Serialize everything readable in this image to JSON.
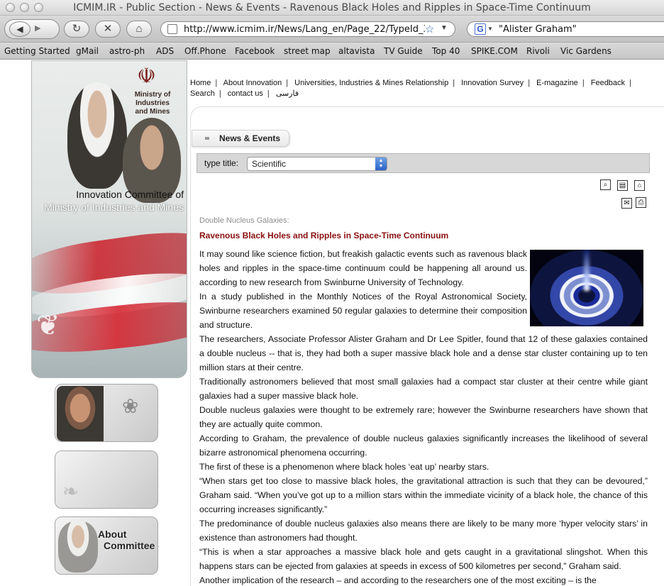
{
  "window": {
    "title": "ICMIM.IR - Public Section - News & Events - Ravenous Black Holes and Ripples in Space-Time Continuum"
  },
  "toolbar": {
    "back": "◀",
    "forward": "▶",
    "reload": "↻",
    "stop": "✕",
    "home": "⌂",
    "url": "http://www.icmim.ir/News/Lang_en/Page_22/TypeId_3/I",
    "search_engine": "G",
    "search_query": "\"Alister Graham\""
  },
  "bookmarks": [
    "Getting Started",
    "gMail",
    "astro-ph",
    "ADS",
    "Off.Phone",
    "Facebook",
    "street map",
    "altavista",
    "TV Guide",
    "Top 40",
    "SPIKE.COM",
    "Rivoli",
    "Vic Gardens"
  ],
  "banner": {
    "ministry_line1": "Ministry of Industries",
    "ministry_line2": "and Mines",
    "committee_title": "Innovation Committee of",
    "committee_sub": "Ministry of Industries and Mines"
  },
  "sidebar": {
    "about_line1": "About",
    "about_line2": "Committee"
  },
  "nav": {
    "items": [
      "Home",
      "About Innovation",
      "Universities, Industries & Mines Relationship",
      "Innovation Survey",
      "E-magazine",
      "Feedback",
      "Search",
      "contact us",
      "فارسی"
    ]
  },
  "section": {
    "title": "News & Events"
  },
  "filter": {
    "label": "type title:",
    "selected": "Scientific"
  },
  "tools": {
    "search_icon": "search-icon",
    "print_icon": "print-icon",
    "home_icon": "home-icon",
    "mail_icon": "mail-icon",
    "printer_icon": "printer-icon"
  },
  "article": {
    "category": "Double Nucleus Galaxies:",
    "headline": "Ravenous Black Holes and Ripples in Space-Time Continuum",
    "paragraphs": [
      "It may sound like science fiction, but freakish galactic events such as ravenous black holes and ripples in the space-time continuum could be happening all around us. according to new research from Swinburne University of Technology.",
      "In a study published in the Monthly Notices of the Royal Astronomical Society, Swinburne researchers examined 50 regular galaxies to determine their composition and structure.",
      "The researchers, Associate Professor Alister Graham and Dr Lee Spitler, found that 12 of these galaxies contained a double nucleus -- that is, they had both a super massive black hole and a dense star cluster containing up to ten million stars at their centre.",
      "Traditionally astronomers believed that most small galaxies had a compact star cluster at their centre while giant galaxies had a super massive black hole.",
      "Double nucleus galaxies were thought to be extremely rare; however the Swinburne researchers have shown that they are actually quite common.",
      "According to Graham, the prevalence of double nucleus galaxies significantly increases the likelihood of several bizarre astronomical phenomena occurring.",
      "The first of these is a phenomenon where black holes ‘eat up’ nearby stars.",
      " “When stars get too close to massive black holes, the gravitational attraction is such that they can be devoured,” Graham said. “When you’ve got up to a million stars within the immediate vicinity of a black hole, the chance of this occurring increases significantly.”",
      "The predominance of double nucleus galaxies also means there are likely to be many more ‘hyper velocity stars’ in existence than astronomers had thought.",
      " “This is when a star approaches a massive black hole and gets caught in a gravitational slingshot. When this happens stars can be ejected from galaxies at speeds in excess of 500 kilometres per second,” Graham said.",
      "Another implication of the research – and according to the researchers one of the most exciting – is the"
    ]
  }
}
